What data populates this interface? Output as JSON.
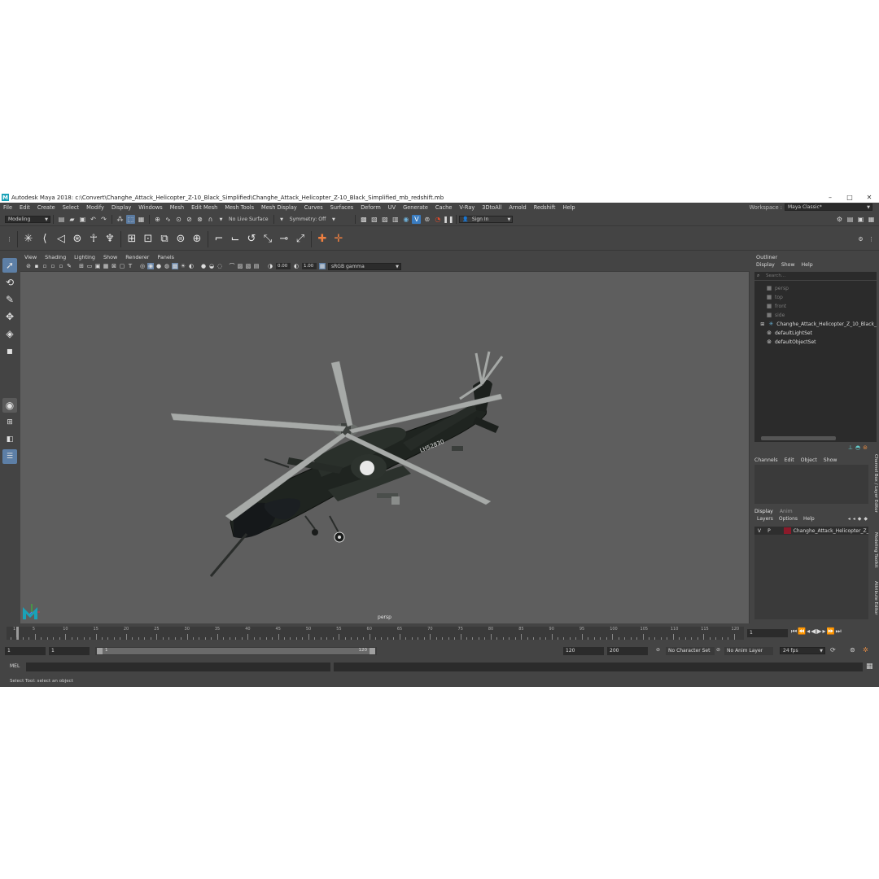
{
  "window": {
    "title": "Autodesk Maya 2018: c:\\Convert\\Changhe_Attack_Helicopter_Z-10_Black_Simplified\\Changhe_Attack_Helicopter_Z-10_Black_Simplified_mb_redshift.mb",
    "logo_letter": "M",
    "minimize": "–",
    "maximize": "□",
    "close": "✕"
  },
  "menu": {
    "items": [
      "File",
      "Edit",
      "Create",
      "Select",
      "Modify",
      "Display",
      "Windows",
      "Mesh",
      "Edit Mesh",
      "Mesh Tools",
      "Mesh Display",
      "Curves",
      "Surfaces",
      "Deform",
      "UV",
      "Generate",
      "Cache",
      "V-Ray",
      "3DtoAll",
      "Arnold",
      "Redshift",
      "Help"
    ],
    "workspace_label": "Workspace :",
    "workspace_value": "Maya Classic*"
  },
  "status": {
    "menuset": "Modeling",
    "live_surface": "No Live Surface",
    "symmetry": "Symmetry: Off",
    "sign_in": "Sign In"
  },
  "viewport": {
    "menu": [
      "View",
      "Shading",
      "Lighting",
      "Show",
      "Renderer",
      "Panels"
    ],
    "exposure": "0.00",
    "gamma": "1.00",
    "color_space": "sRGB gamma",
    "camera": "persp",
    "tail_number": "LH52830"
  },
  "outliner": {
    "title": "Outliner",
    "menu": [
      "Display",
      "Show",
      "Help"
    ],
    "search_placeholder": "Search...",
    "items": [
      {
        "label": "persp",
        "icon": "camera-icon",
        "dim": true
      },
      {
        "label": "top",
        "icon": "camera-icon",
        "dim": true
      },
      {
        "label": "front",
        "icon": "camera-icon",
        "dim": true
      },
      {
        "label": "side",
        "icon": "camera-icon",
        "dim": true
      },
      {
        "label": "Changhe_Attack_Helicopter_Z_10_Black_",
        "icon": "transform-icon",
        "dim": false
      },
      {
        "label": "defaultLightSet",
        "icon": "set-icon",
        "dim": false
      },
      {
        "label": "defaultObjectSet",
        "icon": "set-icon",
        "dim": false
      }
    ]
  },
  "channel_box": {
    "menu": [
      "Channels",
      "Edit",
      "Object",
      "Show"
    ]
  },
  "layer_editor": {
    "tabs": [
      "Display",
      "Anim"
    ],
    "menu": [
      "Layers",
      "Options",
      "Help"
    ],
    "layer": {
      "v": "V",
      "p": "P",
      "name": "Changhe_Attack_Helicopter_Z_",
      "color": "#8b1a2a"
    }
  },
  "side_tabs": [
    "Channel Box / Layer Editor",
    "Modeling Toolkit",
    "Attribute Editor"
  ],
  "timeline": {
    "ticks": [
      "5",
      "10",
      "15",
      "20",
      "25",
      "30",
      "35",
      "40",
      "45",
      "50",
      "55",
      "60",
      "65",
      "70",
      "75",
      "80",
      "85",
      "90",
      "95",
      "100",
      "105",
      "110",
      "115",
      "120"
    ],
    "first_tick": "1",
    "current_frame": "1"
  },
  "range": {
    "start": "1",
    "playback_start": "1",
    "slider_start": "1",
    "slider_end": "120",
    "playback_end": "120",
    "end": "200",
    "character_set": "No Character Set",
    "anim_layer": "No Anim Layer",
    "fps": "24 fps"
  },
  "command": {
    "label": "MEL"
  },
  "help_line": "Select Tool: select an object"
}
